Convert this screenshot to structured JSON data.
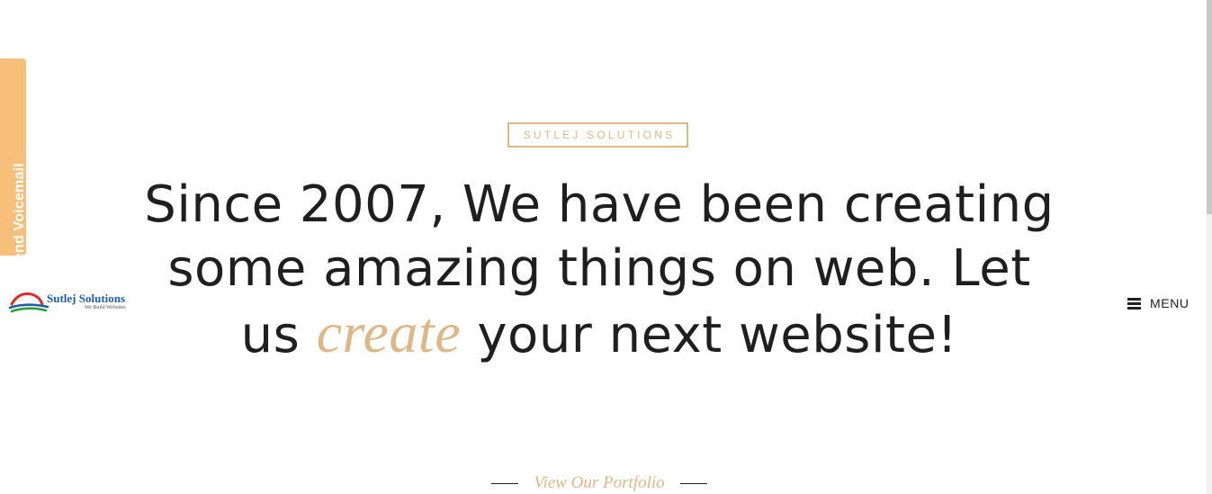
{
  "voicemail": {
    "label": "Send Voicemail"
  },
  "logo": {
    "name": "Sutlej Solutions",
    "tagline": "We Build Websites"
  },
  "menu": {
    "label": "MENU"
  },
  "hero": {
    "badge": "SUTLEJ SOLUTIONS",
    "headline_part1": "Since 2007, We have been creating some amazing things on web. Let us ",
    "headline_accent": "create",
    "headline_part2": " your next website!",
    "portfolio_link": "View Our Portfolio"
  },
  "colors": {
    "accent": "#ddb886",
    "voicemail_bg": "#f8bf7a",
    "text": "#1f1f1f",
    "logo_blue": "#1f5fa8"
  },
  "icons": {
    "voicemail": "microphone-icon",
    "menu": "hamburger-icon"
  }
}
